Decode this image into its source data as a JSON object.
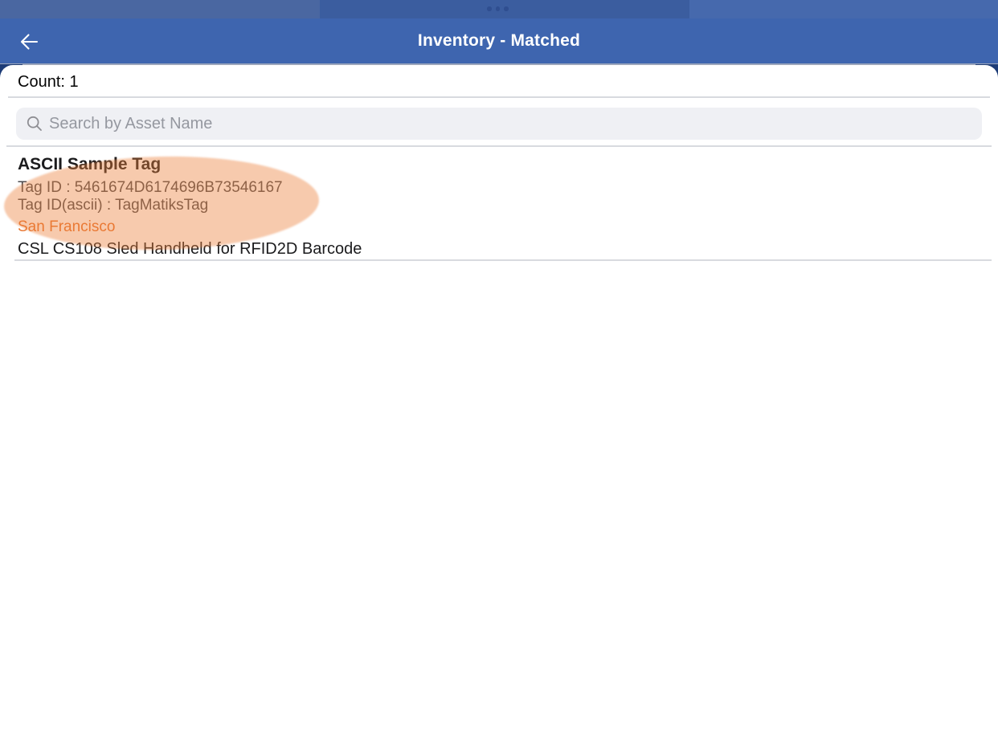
{
  "header": {
    "title": "Inventory - Matched"
  },
  "status_bar": {
    "multitask_indicator_dots": 3
  },
  "summary": {
    "count_label": "Count: 1"
  },
  "search": {
    "placeholder": "Search by Asset Name"
  },
  "list": {
    "items": [
      {
        "asset_name": "ASCII Sample Tag",
        "tag_id": "Tag ID : 5461674D6174696B73546167",
        "tag_id_ascii": "Tag ID(ascii) : TagMatiksTag",
        "location": "San Francisco",
        "device": "CSL CS108 Sled Handheld for RFID2D Barcode"
      }
    ]
  },
  "icons": {
    "back_arrow": "←",
    "search": "⌕"
  },
  "colors": {
    "nav_blue": "#3E65AF",
    "status_strip_blue": "#3B5D9F",
    "corner_backing_navy": "#1D3C77",
    "location_orange": "#E8742E",
    "highlight_peach": "#EC803C",
    "search_field_gray": "#EFF0F4"
  }
}
